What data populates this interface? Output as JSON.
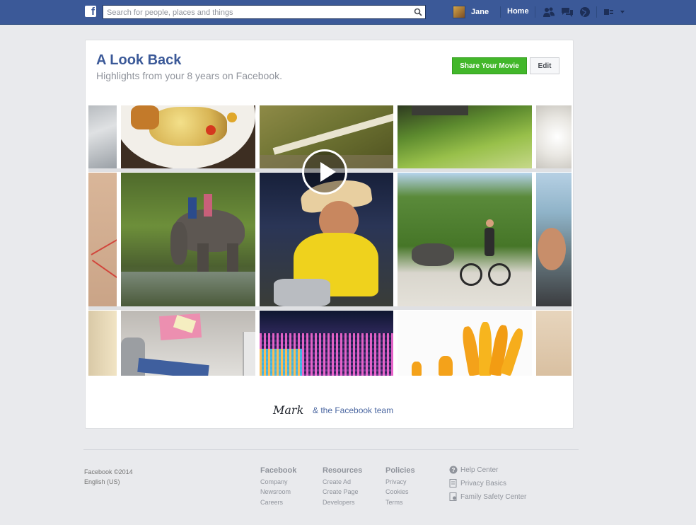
{
  "topbar": {
    "logo": "f",
    "search_placeholder": "Search for people, places and things",
    "user_name": "Jane",
    "home_label": "Home"
  },
  "card": {
    "title": "A Look Back",
    "subtitle": "Highlights from your 8 years on Facebook.",
    "share_label": "Share Your Movie",
    "edit_label": "Edit",
    "signature": "Mark",
    "signature_rest": "& the Facebook team"
  },
  "footer": {
    "copyright": "Facebook ©2014",
    "language": "English (US)",
    "columns": [
      {
        "title": "Facebook",
        "links": [
          "Company",
          "Newsroom",
          "Careers"
        ]
      },
      {
        "title": "Resources",
        "links": [
          "Create Ad",
          "Create Page",
          "Developers"
        ]
      },
      {
        "title": "Policies",
        "links": [
          "Privacy",
          "Cookies",
          "Terms"
        ]
      }
    ],
    "help_links": [
      "Help Center",
      "Privacy Basics",
      "Family Safety Center"
    ]
  },
  "colors": {
    "brand_blue": "#3b5998",
    "share_green": "#42b72a",
    "page_bg": "#e9eaed"
  },
  "icons": [
    "search-icon",
    "friend-requests-icon",
    "messages-icon",
    "notifications-globe-icon",
    "settings-icon",
    "play-icon",
    "help-icon",
    "privacy-icon",
    "family-safety-icon"
  ]
}
